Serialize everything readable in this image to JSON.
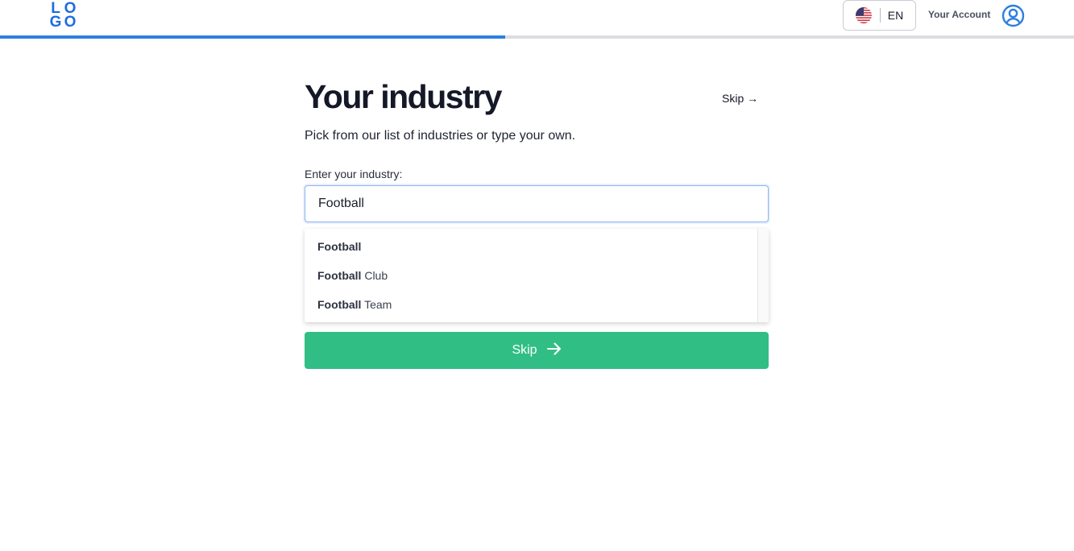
{
  "header": {
    "logo": [
      "L",
      "O",
      "G",
      "O"
    ],
    "language": {
      "label": "EN",
      "flag_icon": "us-flag-icon"
    },
    "account_label": "Your Account",
    "account_icon": "user-circle-icon",
    "progress_percent": 47
  },
  "main": {
    "title": "Your industry",
    "skip_link": "Skip →",
    "subtitle": "Pick from our list of industries or type your own.",
    "field_label": "Enter your industry:",
    "input_value": "Football",
    "suggestions": [
      {
        "match": "Football",
        "rest": ""
      },
      {
        "match": "Football",
        "rest": " Club"
      },
      {
        "match": "Football",
        "rest": " Team"
      }
    ],
    "skip_button": "Skip",
    "skip_button_icon": "arrow-right-icon"
  },
  "colors": {
    "brand": "#1d6ce0",
    "progress": "#2d7fe0",
    "primary_button": "#31be85"
  }
}
